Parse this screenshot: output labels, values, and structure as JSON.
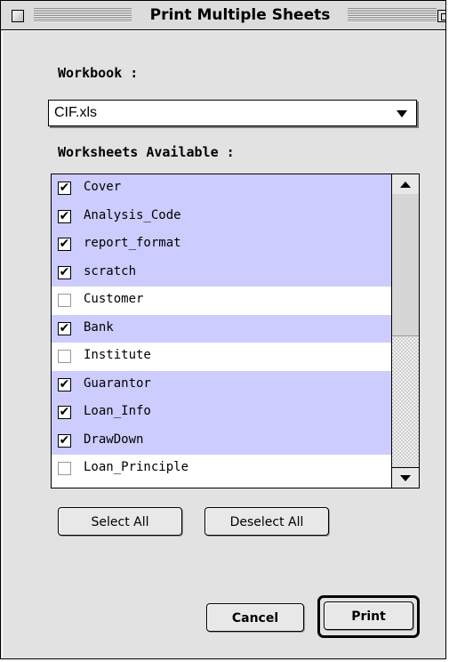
{
  "window": {
    "title": "Print Multiple Sheets"
  },
  "workbook": {
    "label": "Workbook :",
    "selected": "CIF.xls"
  },
  "worksheets": {
    "label": "Worksheets Available :",
    "items": [
      {
        "name": "Cover",
        "checked": true
      },
      {
        "name": "Analysis_Code",
        "checked": true
      },
      {
        "name": "report_format",
        "checked": true
      },
      {
        "name": "scratch",
        "checked": true
      },
      {
        "name": "Customer",
        "checked": false
      },
      {
        "name": "Bank",
        "checked": true
      },
      {
        "name": "Institute",
        "checked": false
      },
      {
        "name": "Guarantor",
        "checked": true
      },
      {
        "name": "Loan_Info",
        "checked": true
      },
      {
        "name": "DrawDown",
        "checked": true
      },
      {
        "name": "Loan_Principle",
        "checked": false
      }
    ]
  },
  "buttons": {
    "select_all": "Select All",
    "deselect_all": "Deselect All",
    "cancel": "Cancel",
    "print": "Print"
  },
  "icons": {
    "check": "checkmark-icon",
    "close": "close-box-icon",
    "zoom": "zoom-box-icon"
  }
}
